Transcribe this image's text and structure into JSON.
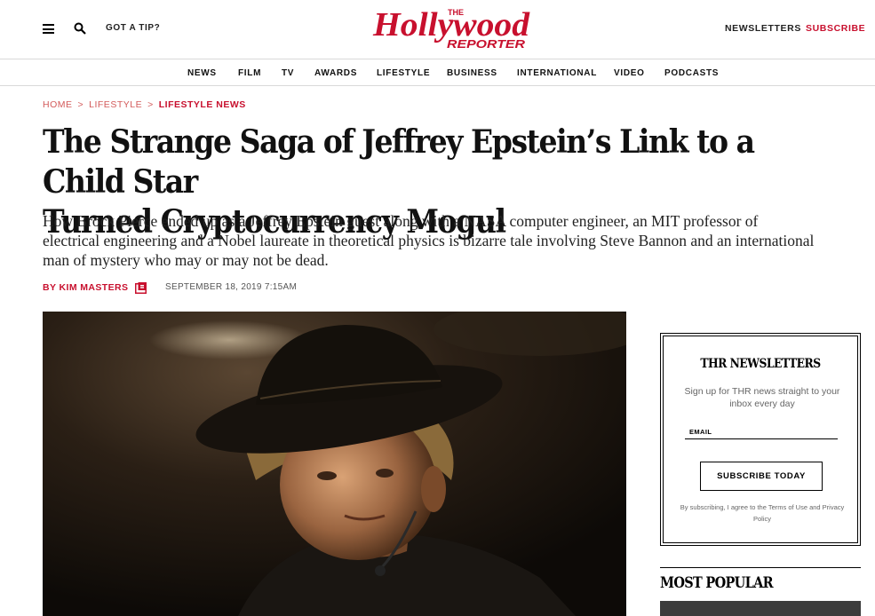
{
  "header": {
    "tip_label": "GOT A TIP?",
    "logo_top": "THE",
    "logo_main": "Hollywood",
    "logo_sub": "REPORTER",
    "newsletters_label": "NEWSLETTERS",
    "subscribe_label": "SUBSCRIBE",
    "brand_color": "#c8102e"
  },
  "nav": {
    "items": [
      "NEWS",
      "FILM",
      "TV",
      "AWARDS",
      "LIFESTYLE",
      "BUSINESS",
      "INTERNATIONAL",
      "VIDEO",
      "PODCASTS"
    ]
  },
  "breadcrumb": {
    "home": "HOME",
    "section": "LIFESTYLE",
    "current": "LIFESTYLE NEWS",
    "separator": ">"
  },
  "article": {
    "headline_line1": "The Strange Saga of Jeffrey Epstein’s Link to a Child Star",
    "headline_line2": "Turned Cryptocurrency Mogul",
    "dek": "How Brock Pierce ended up as a Jeffrey Epstein guest along with a NASA computer engineer, an MIT professor of electrical engineering and a Nobel laureate in theoretical physics is bizarre tale involving Steve Bannon and an international man of mystery who may or may not be dead.",
    "byline": "BY KIM MASTERS",
    "date": "SEPTEMBER 18, 2019 7:15AM"
  },
  "newsletter": {
    "title": "THR NEWSLETTERS",
    "description": "Sign up for THR news straight to your inbox every day",
    "email_label": "EMAIL",
    "button_label": "SUBSCRIBE TODAY",
    "legal": "By subscribing, I agree to the Terms of Use and Privacy Policy"
  },
  "most_popular": {
    "title": "MOST POPULAR"
  },
  "icons": {
    "menu": "hamburger-menu-icon",
    "search": "search-icon",
    "author": "author-page-icon"
  }
}
